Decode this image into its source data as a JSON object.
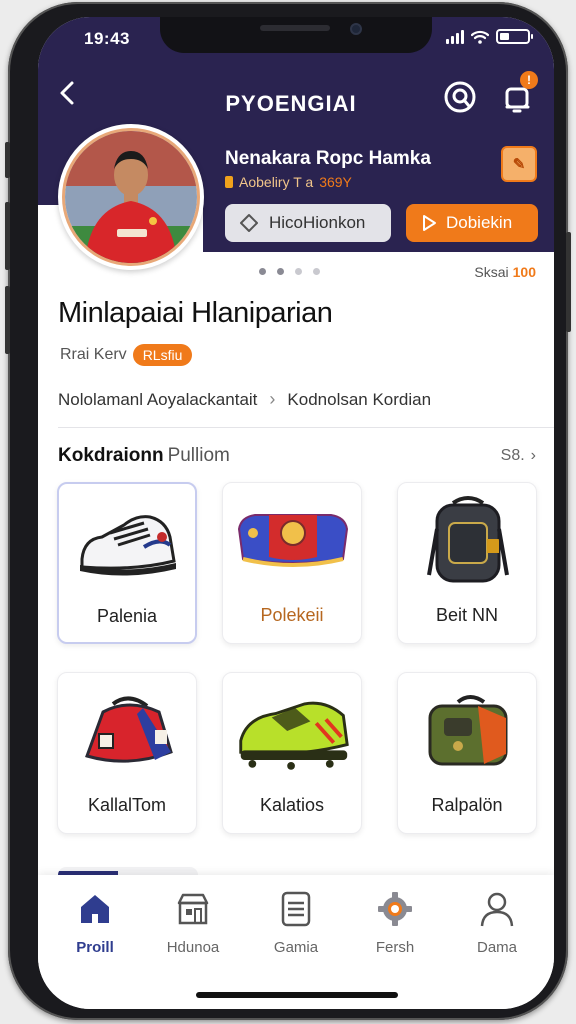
{
  "status": {
    "time": "19:43"
  },
  "header": {
    "title": "PYOENGIAI",
    "notification_count": "!"
  },
  "profile": {
    "name": "Nenakara Ropc Hamka",
    "meta_label": "Aobeliry T a",
    "meta_value": "369Y",
    "secondary_button": "HicoHionkon",
    "primary_button": "Dobiekin"
  },
  "pager": {
    "counter_label": "Sksai",
    "counter_value": "100"
  },
  "main": {
    "title": "Minlapaiai Hlaniparian",
    "role_label": "Rrai Kerv",
    "role_badge": "RLsfiu",
    "breadcrumb": [
      "Nololamanl Aoyalackantait",
      "Kodnolsan Kordian"
    ]
  },
  "collection": {
    "title_bold": "Kokdraionn",
    "title_rest": "Pulliom",
    "see_all": "S8.",
    "items": [
      {
        "label": "Palenia"
      },
      {
        "label": "Polekeii"
      },
      {
        "label": "Beit NN"
      },
      {
        "label": "KallalTom"
      },
      {
        "label": "Kalatios"
      },
      {
        "label": "Ralpalön"
      }
    ]
  },
  "tabs": [
    {
      "label": "Proill"
    },
    {
      "label": "Hdunoa"
    },
    {
      "label": "Gamia"
    },
    {
      "label": "Fersh"
    },
    {
      "label": "Dama"
    }
  ],
  "colors": {
    "header": "#2a2350",
    "accent": "#f07a1a",
    "active_tab": "#2f3d8f"
  }
}
